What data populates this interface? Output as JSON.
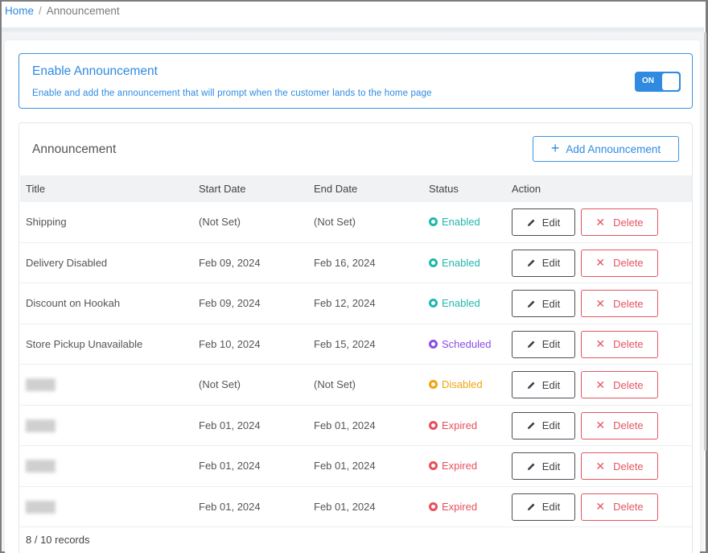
{
  "breadcrumb": {
    "home": "Home",
    "separator": "/",
    "current": "Announcement"
  },
  "enable": {
    "title": "Enable Announcement",
    "description": "Enable and add the announcement that will prompt when the customer lands to the home page",
    "toggle_label": "ON",
    "toggle_state": "on"
  },
  "announcements": {
    "title": "Announcement",
    "add_button": "Add Announcement",
    "columns": {
      "title": "Title",
      "start": "Start Date",
      "end": "End Date",
      "status": "Status",
      "action": "Action"
    },
    "edit_label": "Edit",
    "delete_label": "Delete",
    "rows": [
      {
        "title": "Shipping",
        "start": "(Not Set)",
        "end": "(Not Set)",
        "status": "Enabled"
      },
      {
        "title": "Delivery Disabled",
        "start": "Feb 09, 2024",
        "end": "Feb 16, 2024",
        "status": "Enabled"
      },
      {
        "title": "Discount on Hookah",
        "start": "Feb 09, 2024",
        "end": "Feb 12, 2024",
        "status": "Enabled"
      },
      {
        "title": "Store Pickup Unavailable",
        "start": "Feb 10, 2024",
        "end": "Feb 15, 2024",
        "status": "Scheduled"
      },
      {
        "title": "",
        "start": "(Not Set)",
        "end": "(Not Set)",
        "status": "Disabled",
        "blurred": true
      },
      {
        "title": "",
        "start": "Feb 01, 2024",
        "end": "Feb 01, 2024",
        "status": "Expired",
        "blurred": true
      },
      {
        "title": "",
        "start": "Feb 01, 2024",
        "end": "Feb 01, 2024",
        "status": "Expired",
        "blurred": true
      },
      {
        "title": "",
        "start": "Feb 01, 2024",
        "end": "Feb 01, 2024",
        "status": "Expired",
        "blurred": true
      }
    ],
    "records": "8 / 10 records"
  },
  "colors": {
    "accent": "#2f8ae0",
    "enabled": "#1fb8ad",
    "scheduled": "#8a4de6",
    "disabled": "#f0a50a",
    "expired": "#e8505b",
    "danger": "#e45561"
  }
}
